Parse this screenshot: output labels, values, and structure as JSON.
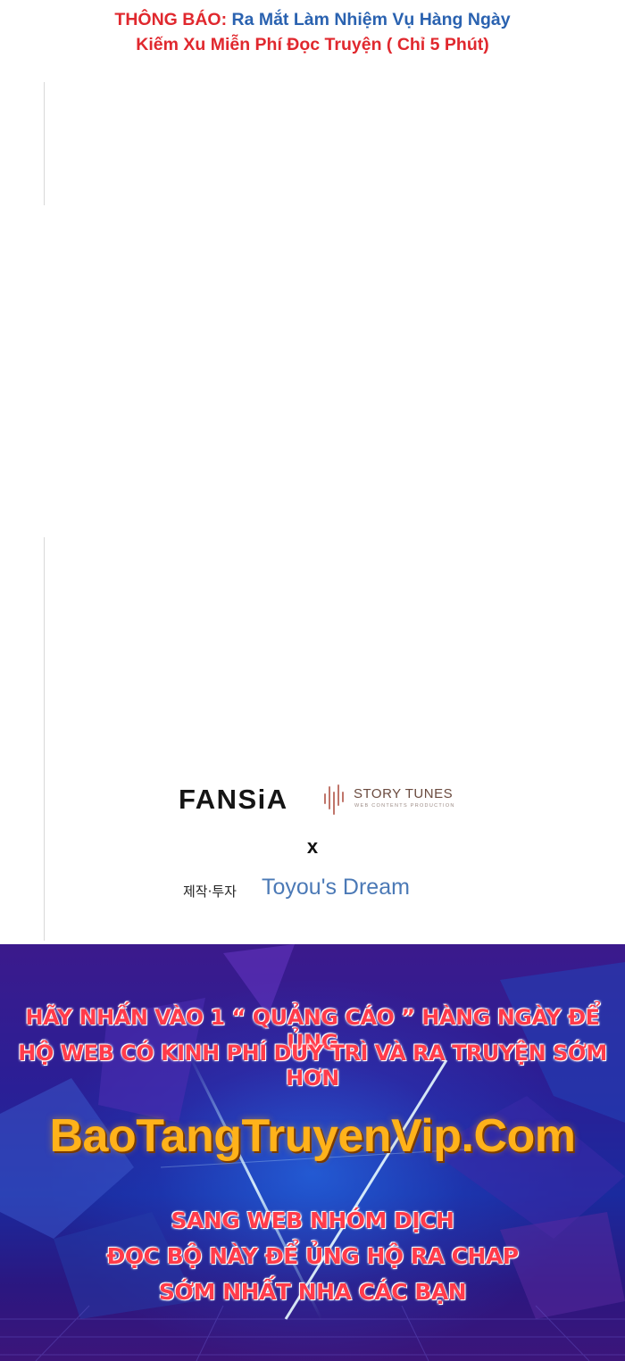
{
  "notice": {
    "line1_lead": "THÔNG BÁO:",
    "line1_rest": " Ra Mắt Làm Nhiệm Vụ Hàng Ngày",
    "line2": "Kiếm Xu Miễn Phí Đọc Truyện ( Chỉ 5 Phút)"
  },
  "credits": {
    "fansia": "FANSiA",
    "story_tunes": "STORY TUNES",
    "story_tunes_sub": "WEB CONTENTS PRODUCTION",
    "x": "x",
    "korean": "제작·투자",
    "toyou": "Toyou's Dream"
  },
  "banner": {
    "line1": "HÃY NHẤN VÀO 1 “ QUẢNG CÁO ” HÀNG NGÀY ĐỂ ỦNG",
    "line2": "HỘ WEB CÓ KINH PHÍ DUY TRÌ VÀ RA TRUYỆN SỚM HƠN",
    "site": "BaoTangTruyenVip.Com",
    "line3": "SANG WEB NHÓM DỊCH",
    "line4": "ĐỌC BỘ NÀY  ĐỂ ỦNG HỘ RA CHAP",
    "line5": "SỚM NHẤT NHA CÁC BẠN"
  },
  "colors": {
    "notice_red": "#e0282e",
    "notice_blue": "#2a62b0",
    "banner_text_red": "#ff3b4a",
    "site_orange": "#ffb21a",
    "toyou_blue": "#4b79b6"
  }
}
